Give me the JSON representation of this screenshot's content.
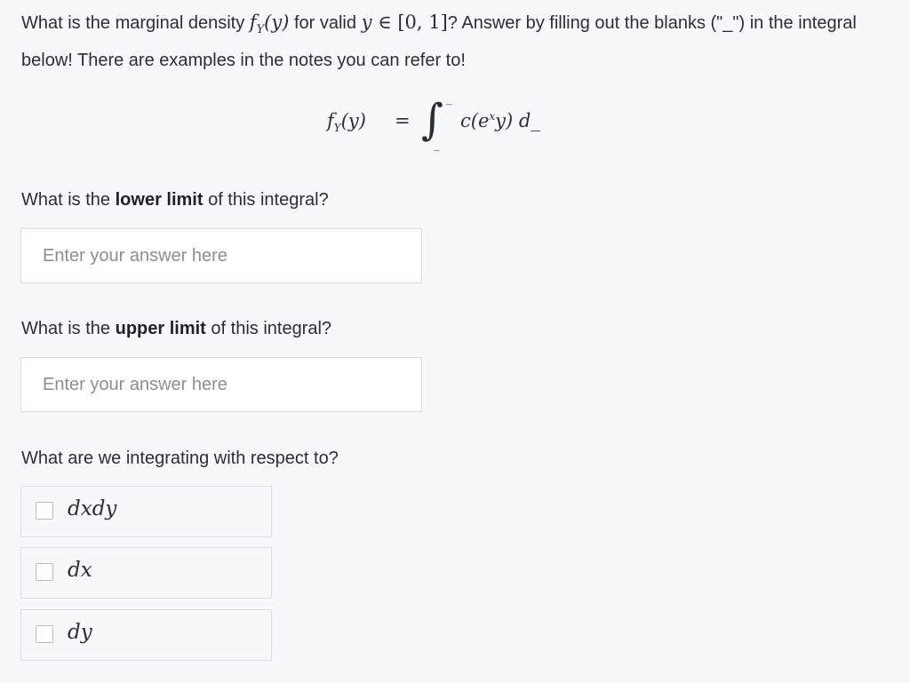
{
  "question": {
    "part1": "What is the marginal density ",
    "f": "f",
    "f_sub": "Y",
    "f_arg": "(y)",
    "part2": " for valid ",
    "y_in": "y ∈ ",
    "interval": "[0, 1]",
    "part3": "? Answer by filling out the blanks (\"_\") in the integral below! There are examples in the notes you can refer to!"
  },
  "equation": {
    "lhs_f": "f",
    "lhs_sub": "Y",
    "lhs_arg": "(y)",
    "equals": "=",
    "integral": "∫",
    "upper": "_",
    "lower": "_",
    "body_pre": "c(e",
    "body_sup": "x",
    "body_post": "y) d_"
  },
  "lower_limit": {
    "label_pre": "What is the ",
    "label_bold": "lower limit",
    "label_post": " of this integral?",
    "value": "",
    "placeholder": "Enter your answer here"
  },
  "upper_limit": {
    "label_pre": "What is the ",
    "label_bold": "upper limit",
    "label_post": " of this integral?",
    "value": "",
    "placeholder": "Enter your answer here"
  },
  "respect": {
    "label": "What are we integrating with respect to?",
    "options": [
      {
        "label": "dxdy",
        "checked": false
      },
      {
        "label": "dx",
        "checked": false
      },
      {
        "label": "dy",
        "checked": false
      }
    ]
  }
}
